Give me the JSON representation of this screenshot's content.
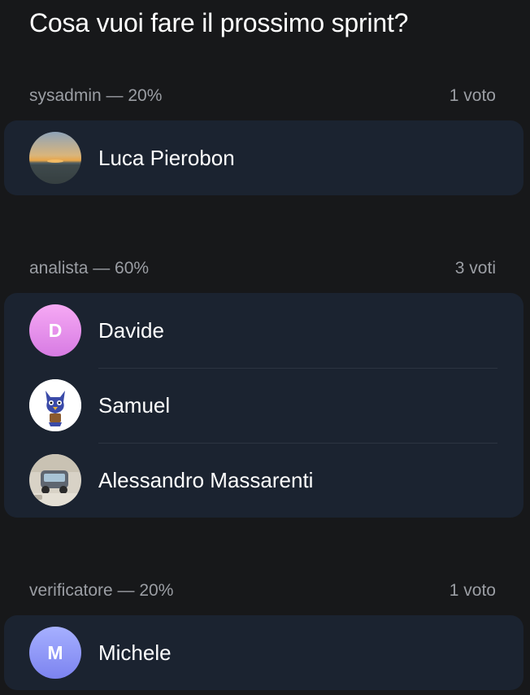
{
  "poll": {
    "question": "Cosa vuoi fare il prossimo sprint?"
  },
  "options": [
    {
      "label": "sysadmin — 20%",
      "count": "1 voto",
      "voters": [
        {
          "name": "Luca Pierobon",
          "avatar": "sunset-photo"
        }
      ]
    },
    {
      "label": "analista — 60%",
      "count": "3 voti",
      "voters": [
        {
          "name": "Davide",
          "initial": "D",
          "avatar": "initial-pink"
        },
        {
          "name": "Samuel",
          "avatar": "blue-bird-cartoon"
        },
        {
          "name": "Alessandro Massarenti",
          "avatar": "car-photo"
        }
      ]
    },
    {
      "label": "verificatore — 20%",
      "count": "1 voto",
      "voters": [
        {
          "name": "Michele",
          "initial": "M",
          "avatar": "initial-violet"
        }
      ]
    }
  ],
  "colors": {
    "background": "#17181a",
    "card": "#1b2330",
    "muted_text": "#9b9ea4",
    "davide_gradient": [
      "#f6a9f4",
      "#d77be3"
    ],
    "michele_gradient": [
      "#a6b0ff",
      "#7c83f0"
    ]
  }
}
